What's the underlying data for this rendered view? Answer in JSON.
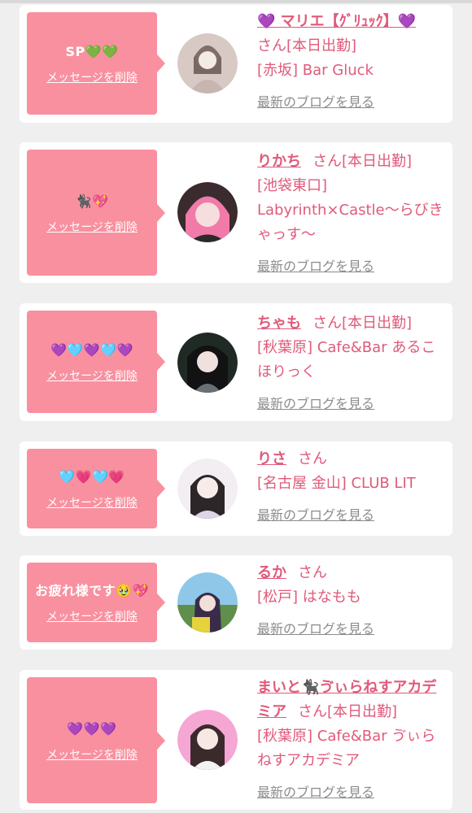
{
  "cards": [
    {
      "message": "SP💚💚",
      "delete_label": "メッセージを削除",
      "name": "💜 マリエ【ｸﾞﾘｭｯｸ】💜",
      "honorific": "さん[本日出勤]",
      "shop": "[赤坂] Bar Gluck",
      "blog_label": "最新のブログを見る",
      "avatar_icon": "girl-photo-avatar"
    },
    {
      "message": "🐈‍⬛💖",
      "delete_label": "メッセージを削除",
      "name": "りかち",
      "honorific": "さん[本日出勤]",
      "shop": "[池袋東口] Labyrinth×Castle〜らびきゃっす〜",
      "blog_label": "最新のブログを見る",
      "avatar_icon": "girl-photo-avatar"
    },
    {
      "message": "💜🩵💜🩵💜",
      "delete_label": "メッセージを削除",
      "name": "ちゃも",
      "honorific": "さん[本日出勤]",
      "shop": "[秋葉原] Cafe&Bar あるこほりっく",
      "blog_label": "最新のブログを見る",
      "avatar_icon": "girl-photo-avatar"
    },
    {
      "message": "🩵💗🩵💗",
      "delete_label": "メッセージを削除",
      "name": "りさ",
      "honorific": "さん",
      "shop": "[名古屋 金山] CLUB LIT",
      "blog_label": "最新のブログを見る",
      "avatar_icon": "girl-photo-avatar"
    },
    {
      "message": "お疲れ様です🥹💖",
      "delete_label": "メッセージを削除",
      "name": "るか",
      "honorific": "さん",
      "shop": "[松戸] はなもも",
      "blog_label": "最新のブログを見る",
      "avatar_icon": "girl-photo-avatar"
    },
    {
      "message": "💜💜💜",
      "delete_label": "メッセージを削除",
      "name": "まいと🐈‍⬛ゔぃらねすアカデミア",
      "honorific": "さん[本日出勤]",
      "shop": "[秋葉原] Cafe&Bar ゔぃらねすアカデミア",
      "blog_label": "最新のブログを見る",
      "avatar_icon": "girl-photo-avatar"
    }
  ],
  "colors": {
    "bubble": "#f9909f",
    "accent_text": "#e05a7a",
    "muted_link": "#8c8c8c",
    "background": "#efefef",
    "card": "#ffffff"
  }
}
